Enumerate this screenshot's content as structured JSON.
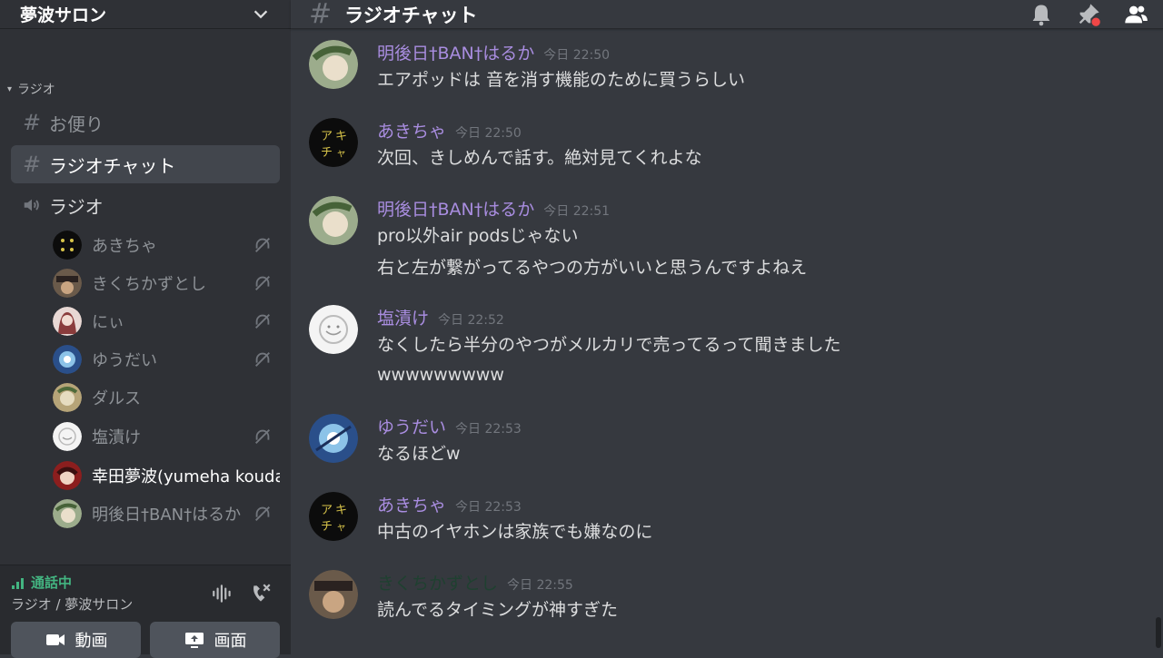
{
  "server": {
    "name": "夢波サロン"
  },
  "sidebar": {
    "category": "ラジオ",
    "channels": [
      {
        "name": "お便り",
        "type": "text"
      },
      {
        "name": "ラジオチャット",
        "type": "text",
        "selected": true
      },
      {
        "name": "ラジオ",
        "type": "voice"
      }
    ],
    "voice_users": [
      {
        "name": "あきちゃ",
        "deafened": true
      },
      {
        "name": "きくちかずとし",
        "deafened": true
      },
      {
        "name": "にぃ",
        "deafened": true
      },
      {
        "name": "ゆうだい",
        "deafened": true
      },
      {
        "name": "ダルス",
        "deafened": false
      },
      {
        "name": "塩漬け",
        "deafened": true
      },
      {
        "name": "幸田夢波(yumeha kouda)",
        "deafened": false
      },
      {
        "name": "明後日†BAN†はるか",
        "deafened": true
      }
    ]
  },
  "voice_status": {
    "state": "通話中",
    "location": "ラジオ / 夢波サロン",
    "video_label": "動画",
    "screen_label": "画面"
  },
  "chat": {
    "channel_name": "ラジオチャット",
    "messages": [
      {
        "author": "明後日†BAN†はるか",
        "time": "今日 22:50",
        "lines": [
          "エアポッドは 音を消す機能のために買うらしい"
        ]
      },
      {
        "author": "あきちゃ",
        "time": "今日 22:50",
        "lines": [
          "次回、きしめんで話す。絶対見てくれよな"
        ]
      },
      {
        "author": "明後日†BAN†はるか",
        "time": "今日 22:51",
        "lines": [
          "pro以外air podsじゃない",
          "右と左が繋がってるやつの方がいいと思うんですよねえ"
        ]
      },
      {
        "author": "塩漬け",
        "time": "今日 22:52",
        "lines": [
          "なくしたら半分のやつがメルカリで売ってるって聞きました",
          "wwwwwwwww"
        ]
      },
      {
        "author": "ゆうだい",
        "time": "今日 22:53",
        "lines": [
          "なるほどw"
        ]
      },
      {
        "author": "あきちゃ",
        "time": "今日 22:53",
        "lines": [
          "中古のイヤホンは家族でも嫌なのに"
        ]
      },
      {
        "author": "きくちかずとし",
        "time": "今日 22:55",
        "lines": [
          "読んでるタイミングが神すぎた"
        ]
      }
    ]
  },
  "colors": {
    "accent_name": "#a98de0",
    "connected": "#43b581",
    "pin_dot": "#f04747"
  },
  "icons": {
    "header": [
      "bell-icon",
      "pin-icon",
      "members-icon"
    ],
    "sidebar": [
      "chevron-down-icon",
      "hash-icon",
      "speaker-icon",
      "deafened-icon"
    ],
    "voice": [
      "signal-icon",
      "noise-suppression-icon",
      "disconnect-icon",
      "camera-icon",
      "screen-share-icon"
    ]
  }
}
